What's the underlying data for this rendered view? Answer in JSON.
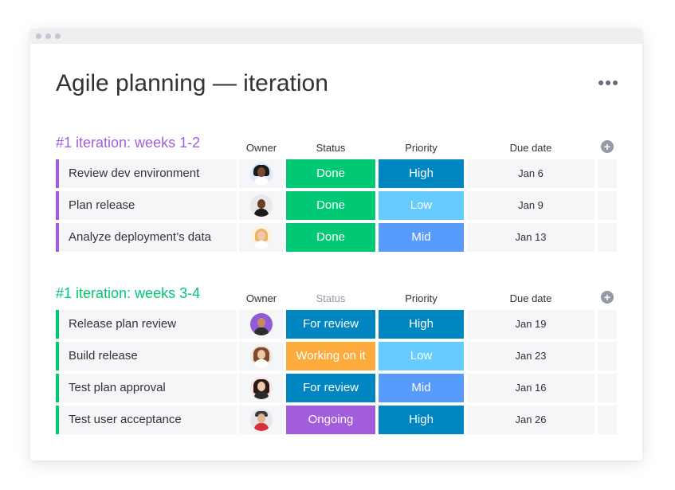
{
  "board": {
    "title": "Agile planning — iteration",
    "menu_icon": "more-dots-icon"
  },
  "columns": {
    "owner": "Owner",
    "status": "Status",
    "priority": "Priority",
    "due_date": "Due date",
    "add_icon": "plus-circle-icon"
  },
  "colors": {
    "group1": "#a25ddc",
    "group2": "#00c875",
    "done": "#00c875",
    "for_review": "#0086c0",
    "working": "#fdab3d",
    "ongoing": "#a25ddc",
    "high": "#0086c0",
    "low": "#66ccff",
    "mid": "#579bfc"
  },
  "groups": [
    {
      "title": "#1 iteration: weeks 1-2",
      "rows": [
        {
          "name": "Review dev environment",
          "status": "Done",
          "priority": "High",
          "due": "Jan 6"
        },
        {
          "name": "Plan release",
          "status": "Done",
          "priority": "Low",
          "due": "Jan 9"
        },
        {
          "name": "Analyze deployment’s data",
          "status": "Done",
          "priority": "Mid",
          "due": "Jan 13"
        }
      ]
    },
    {
      "title": "#1 iteration: weeks 3-4",
      "rows": [
        {
          "name": "Release plan review",
          "status": "For review",
          "priority": "High",
          "due": "Jan 19"
        },
        {
          "name": "Build release",
          "status": "Working on it",
          "priority": "Low",
          "due": "Jan 23"
        },
        {
          "name": "Test plan approval",
          "status": "For review",
          "priority": "Mid",
          "due": "Jan 16"
        },
        {
          "name": "Test user acceptance",
          "status": "Ongoing",
          "priority": "High",
          "due": "Jan 26"
        }
      ]
    }
  ]
}
